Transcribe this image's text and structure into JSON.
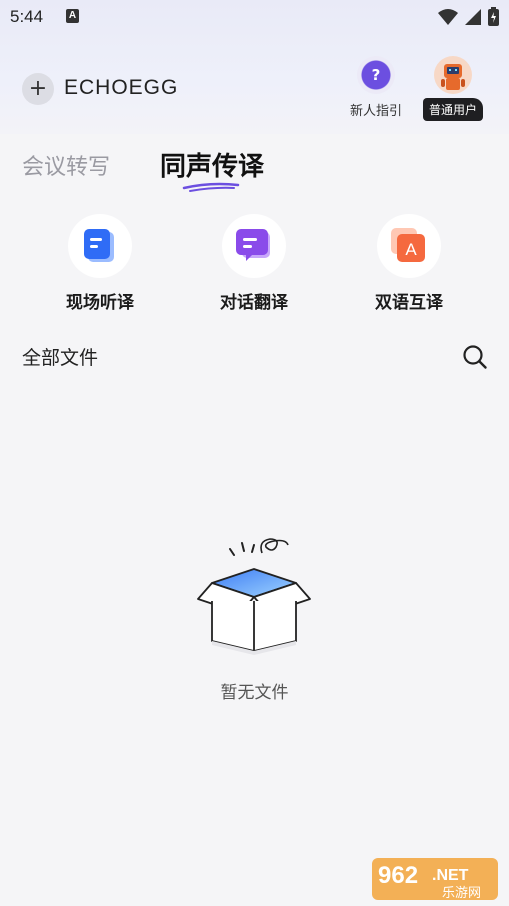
{
  "status_bar": {
    "time": "5:44",
    "notification_letter": "A"
  },
  "header": {
    "logo_text": "ECHOEGG",
    "guide_label": "新人指引",
    "guide_icon_text": "?",
    "user_badge": "普通用户"
  },
  "tabs": [
    {
      "label": "会议转写",
      "active": false
    },
    {
      "label": "同声传译",
      "active": true
    }
  ],
  "features": [
    {
      "label": "现场听译",
      "icon": "document-icon",
      "color": "#2f6cf6"
    },
    {
      "label": "对话翻译",
      "icon": "chat-bubble-icon",
      "color": "#8a4bea"
    },
    {
      "label": "双语互译",
      "icon": "letter-a-icon",
      "color": "#f5693f",
      "icon_text": "A"
    }
  ],
  "files": {
    "title": "全部文件",
    "empty_text": "暂无文件"
  },
  "watermark": {
    "number": "962",
    "domain": ".NET",
    "sub": "乐游网"
  },
  "colors": {
    "accent": "#6c4fe0",
    "background": "#f5f5f7"
  }
}
